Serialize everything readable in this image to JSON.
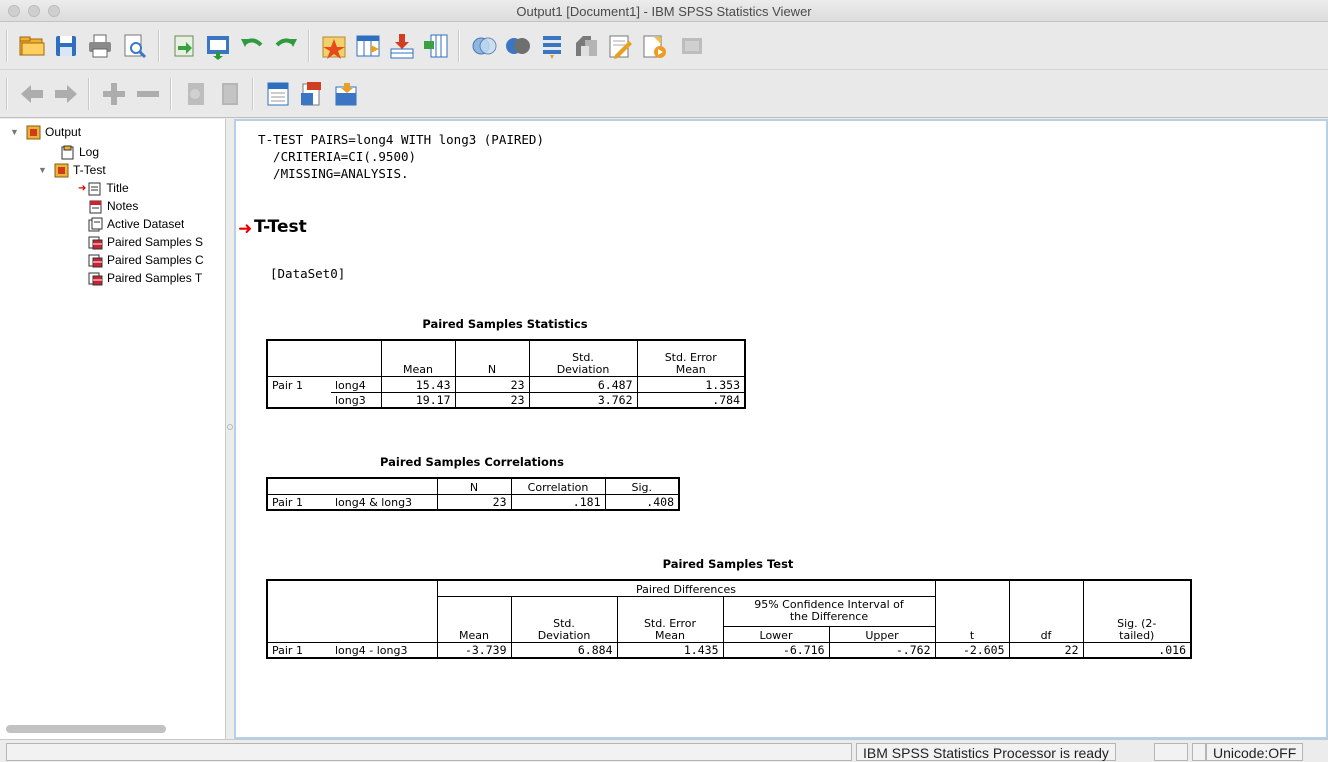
{
  "window": {
    "title": "Output1 [Document1] - IBM SPSS Statistics Viewer"
  },
  "toolbar1": {
    "buttons": [
      "open-icon",
      "save-icon",
      "print-icon",
      "print-preview-icon",
      "export-icon",
      "recall-dialog-icon",
      "undo-icon",
      "redo-icon",
      "goto-case-icon",
      "goto-variable-icon",
      "insert-cases-icon",
      "insert-variables-icon",
      "select-cases-icon",
      "weight-cases-icon",
      "value-labels-icon",
      "use-sets-icon",
      "edit-icon",
      "script-icon",
      "disabled-pane-icon"
    ]
  },
  "toolbar2": {
    "buttons": [
      "promote-icon",
      "demote-icon",
      "expand-icon",
      "collapse-icon",
      "show-icon",
      "hide-icon",
      "insert-heading-icon",
      "insert-title-icon",
      "insert-text-icon"
    ]
  },
  "outline": {
    "items": [
      {
        "label": "Output",
        "icon": "output-book-icon"
      },
      {
        "label": "Log",
        "icon": "log-icon"
      },
      {
        "label": "T-Test",
        "icon": "output-book-icon"
      },
      {
        "label": "Title",
        "icon": "title-icon"
      },
      {
        "label": "Notes",
        "icon": "notes-icon"
      },
      {
        "label": "Active Dataset",
        "icon": "dataset-icon"
      },
      {
        "label": "Paired Samples S",
        "icon": "table-icon"
      },
      {
        "label": "Paired Samples C",
        "icon": "table-icon"
      },
      {
        "label": "Paired Samples T",
        "icon": "table-icon"
      }
    ]
  },
  "content": {
    "syntax_lines": [
      "T-TEST PAIRS=long4 WITH long3 (PAIRED)",
      "  /CRITERIA=CI(.9500)",
      "  /MISSING=ANALYSIS."
    ],
    "heading": "T-Test",
    "dataset": "[DataSet0]",
    "stats": {
      "caption": "Paired Samples Statistics",
      "headers": [
        "Mean",
        "N",
        "Std.\nDeviation",
        "Std. Error\nMean"
      ],
      "pair_label": "Pair 1",
      "rows": [
        {
          "var": "long4",
          "mean": "15.43",
          "n": "23",
          "sd": "6.487",
          "se": "1.353"
        },
        {
          "var": "long3",
          "mean": "19.17",
          "n": "23",
          "sd": "3.762",
          "se": ".784"
        }
      ]
    },
    "corr": {
      "caption": "Paired Samples Correlations",
      "headers": [
        "N",
        "Correlation",
        "Sig."
      ],
      "row": {
        "pair": "Pair 1",
        "label": "long4 & long3",
        "n": "23",
        "r": ".181",
        "sig": ".408"
      }
    },
    "test": {
      "caption": "Paired Samples Test",
      "group": "Paired Differences",
      "ci_group": "95% Confidence Interval of\nthe Difference",
      "headers": {
        "mean": "Mean",
        "sd": "Std.\nDeviation",
        "se": "Std. Error\nMean",
        "lower": "Lower",
        "upper": "Upper",
        "t": "t",
        "df": "df",
        "sig": "Sig. (2-\ntailed)"
      },
      "row": {
        "pair": "Pair 1",
        "label": "long4 - long3",
        "mean": "-3.739",
        "sd": "6.884",
        "se": "1.435",
        "lower": "-6.716",
        "upper": "-.762",
        "t": "-2.605",
        "df": "22",
        "sig": ".016"
      }
    }
  },
  "status": {
    "processor": "IBM SPSS Statistics Processor is ready",
    "unicode": "Unicode:OFF"
  }
}
